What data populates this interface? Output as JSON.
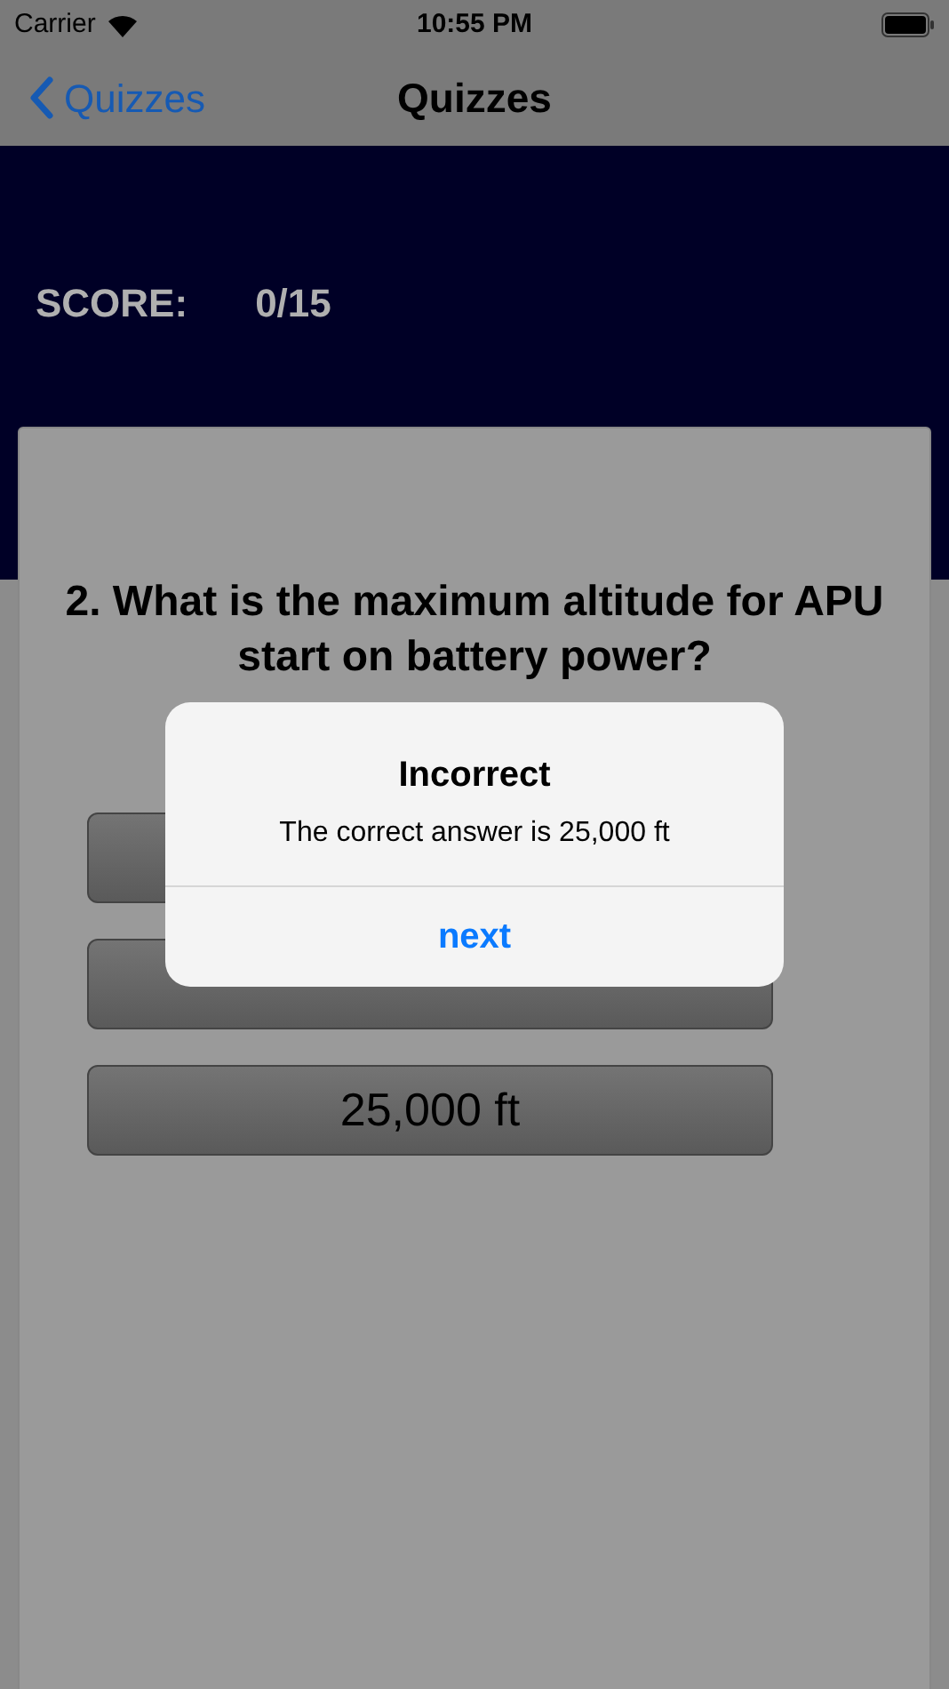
{
  "status_bar": {
    "carrier": "Carrier",
    "time": "10:55 PM"
  },
  "nav_bar": {
    "back": "Quizzes",
    "title": "Quizzes"
  },
  "score": {
    "label": "SCORE:",
    "value": "0/15"
  },
  "question": "2. What is the maximum altitude for APU start on battery power?",
  "answers": [
    {
      "kind": "blank"
    },
    {
      "kind": "blank"
    },
    {
      "kind": "labeled",
      "label": "25,000 ft"
    }
  ],
  "alert": {
    "title": "Incorrect",
    "message": "The correct answer is 25,000 ft",
    "button": "next"
  }
}
